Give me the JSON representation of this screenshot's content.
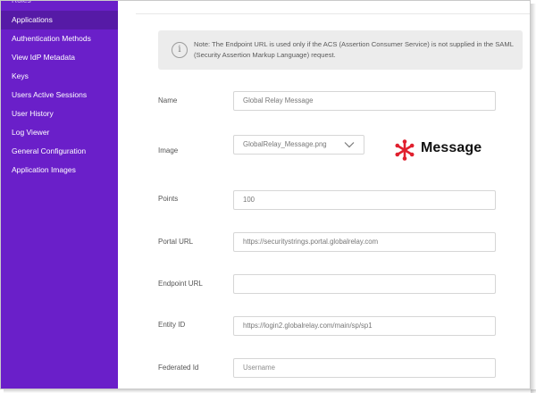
{
  "sidebar": {
    "partial_item": "Roles",
    "items": [
      {
        "label": "Applications",
        "active": true
      },
      {
        "label": "Authentication Methods"
      },
      {
        "label": "View IdP Metadata"
      },
      {
        "label": "Keys"
      },
      {
        "label": "Users Active Sessions"
      },
      {
        "label": "User History"
      },
      {
        "label": "Log Viewer"
      },
      {
        "label": "General Configuration"
      },
      {
        "label": "Application Images"
      }
    ]
  },
  "note": {
    "icon": "info-icon",
    "text": "Note: The Endpoint URL is used only if the ACS (Assertion Consumer Service) is not supplied in the SAML (Security Assertion Markup Language) request."
  },
  "form": {
    "name": {
      "label": "Name",
      "value": "Global Relay Message"
    },
    "image": {
      "label": "Image",
      "value": "GlobalRelay_Message.png",
      "preview_text": "Message",
      "preview_color": "#e0202e"
    },
    "points": {
      "label": "Points",
      "value": "100"
    },
    "portal_url": {
      "label": "Portal URL",
      "value": "https://securitystrings.portal.globalrelay.com"
    },
    "endpoint_url": {
      "label": "Endpoint URL",
      "value": ""
    },
    "entity_id": {
      "label": "Entity ID",
      "value": "https://login2.globalrelay.com/main/sp/sp1"
    },
    "federated_id": {
      "label": "Federated Id",
      "placeholder": "Username"
    }
  },
  "colors": {
    "sidebar_bg": "#6a1fc9",
    "sidebar_active": "#561aa6",
    "note_bg": "#ececec"
  }
}
